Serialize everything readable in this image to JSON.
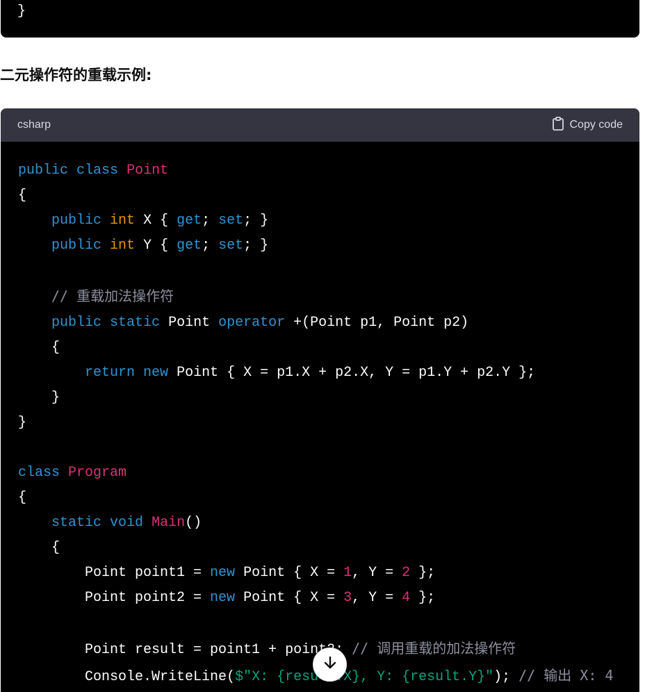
{
  "top_block": {
    "code_tail": "}"
  },
  "heading": "二元操作符的重载示例:",
  "code_block": {
    "language": "csharp",
    "copy_label": "Copy code",
    "lines": [
      "public class Point",
      "{",
      "    public int X { get; set; }",
      "    public int Y { get; set; }",
      "",
      "    // 重载加法操作符",
      "    public static Point operator +(Point p1, Point p2)",
      "    {",
      "        return new Point { X = p1.X + p2.X, Y = p1.Y + p2.Y };",
      "    }",
      "}",
      "",
      "class Program",
      "{",
      "    static void Main()",
      "    {",
      "        Point point1 = new Point { X = 1, Y = 2 };",
      "        Point point2 = new Point { X = 3, Y = 4 };",
      "",
      "        Point result = point1 + point2; // 调用重载的加法操作符",
      "        Console.WriteLine($\"X: {result.X}, Y: {result.Y}\"); // 输出 X: 4"
    ]
  },
  "icons": {
    "copy": "clipboard-icon",
    "scroll": "arrow-down-icon"
  },
  "colors": {
    "code_bg": "#000000",
    "header_bg": "#343541",
    "keyword": "#2e95d3",
    "type": "#e9950c",
    "class_name": "#df3079",
    "number": "#df3079",
    "string": "#00a67d",
    "comment": "#8e8ea0"
  }
}
